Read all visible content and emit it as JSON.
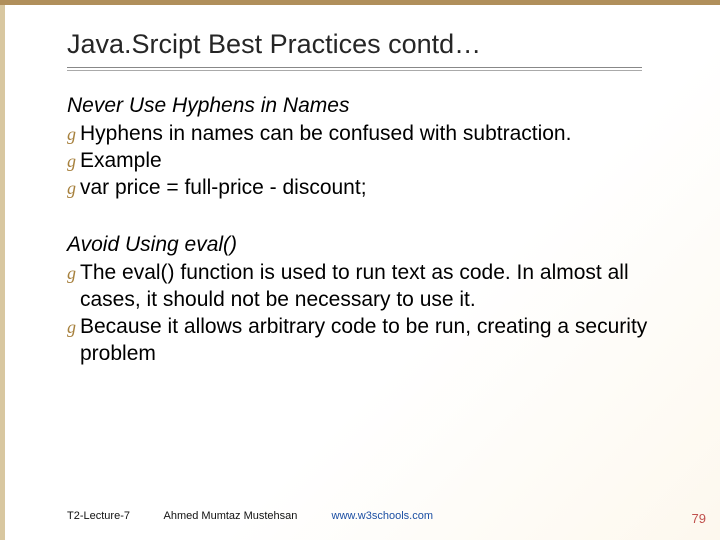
{
  "title": "Java.Srcipt Best Practices contd…",
  "section1": {
    "heading": "Never Use Hyphens in Names",
    "b1": "Hyphens in names can be confused with subtraction.",
    "b2": "Example",
    "b3": "var price = full-price - discount;"
  },
  "section2": {
    "heading": "Avoid Using eval()",
    "b1": "The eval() function is used to run text as code. In almost all cases, it should not be necessary to use it.",
    "b2": "Because it allows arbitrary code to be run, creating a security problem"
  },
  "footer": {
    "lecture": "T2-Lecture-7",
    "author": "Ahmed Mumtaz Mustehsan",
    "url": "www.w3schools.com"
  },
  "page_number": "79",
  "bullet_glyph": "g"
}
